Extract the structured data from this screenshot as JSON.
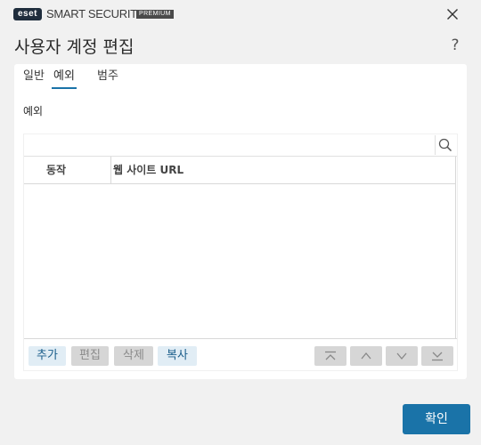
{
  "app": {
    "logo": "eset",
    "product": "SMART SECURITY",
    "edition": "PREMIUM"
  },
  "dialog": {
    "title": "사용자 계정 편집",
    "help": "?"
  },
  "tabs": [
    {
      "label": "일반",
      "active": false
    },
    {
      "label": "예외",
      "active": true
    },
    {
      "label": "범주",
      "active": false
    }
  ],
  "section": {
    "label": "예외"
  },
  "search": {
    "placeholder": "",
    "value": ""
  },
  "table": {
    "columns": [
      "동작",
      "웹 사이트 URL"
    ],
    "rows": []
  },
  "actions": {
    "add": "추가",
    "edit": "편집",
    "delete": "삭제",
    "copy": "복사"
  },
  "footer": {
    "ok": "확인"
  },
  "colors": {
    "accent": "#1a73a8",
    "background": "#f1f1f1",
    "panel": "#ffffff"
  },
  "icons": [
    "close-icon",
    "search-icon",
    "move-top-icon",
    "move-up-icon",
    "move-down-icon",
    "move-bottom-icon"
  ]
}
